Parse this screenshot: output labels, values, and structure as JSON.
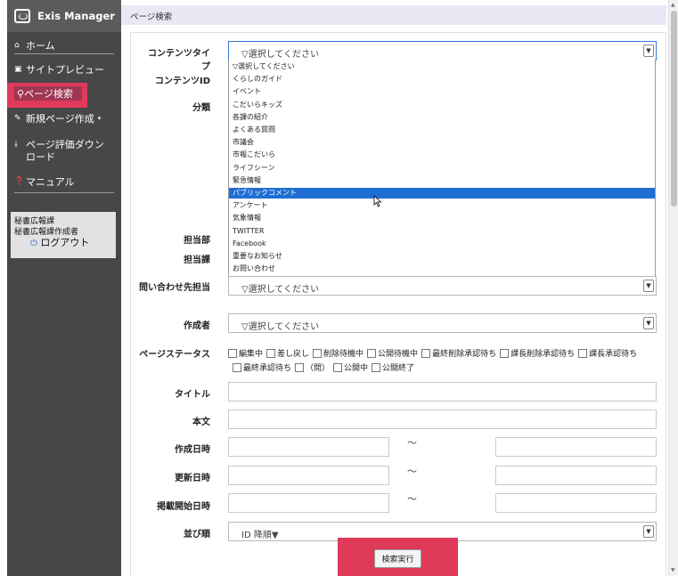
{
  "app": {
    "title": "Exis Manager"
  },
  "nav": {
    "home": "ホーム",
    "site_preview": "サイトプレビュー",
    "page_search": "ページ検索",
    "new_page": "新規ページ作成",
    "eval_download_1": "ページ評価ダウン",
    "eval_download_2": "ロード",
    "manual": "マニュアル"
  },
  "user": {
    "dept": "秘書広報課",
    "role": "秘書広報課作成者",
    "logout": "ログアウト"
  },
  "breadcrumb": "ページ検索",
  "form": {
    "content_type_label": "コンテンツタイプ",
    "content_type_value": "▽選択してください",
    "content_id_label": "コンテンツID",
    "category_label": "分類",
    "dept_label": "担当部",
    "section_label": "担当課",
    "contact_label": "問い合わせ先担当",
    "contact_value": "▽選択してください",
    "author_label": "作成者",
    "author_value": "▽選択してください",
    "status_label": "ページステータス",
    "status_row1": [
      "編集中",
      "差し戻し",
      "削除待機中",
      "公開待機中",
      "最終削除承認待ち",
      "課長削除承認待ち",
      "課長承認待ち"
    ],
    "status_row2": [
      "最終承認待ち",
      "（問）",
      "公開中",
      "公開終了"
    ],
    "title_label": "タイトル",
    "body_label": "本文",
    "created_label": "作成日時",
    "updated_label": "更新日時",
    "published_label": "掲載開始日時",
    "tilde": "～",
    "sort_label": "並び順",
    "sort_value": "ID 降順▼",
    "search_button": "検索実行"
  },
  "dropdown_options": [
    "▽選択してください",
    "くらしのガイド",
    "イベント",
    "こだいらキッズ",
    "各課の紹介",
    "よくある質問",
    "市議会",
    "市報こだいら",
    "ライフシーン",
    "緊急情報",
    "パブリックコメント",
    "アンケート",
    "気象情報",
    "TWITTER",
    "Facebook",
    "重要なお知らせ",
    "お問い合わせ"
  ],
  "dropdown_selected_index": 10,
  "colors": {
    "sidebar": "#474747",
    "highlight": "#e03a5a",
    "selected": "#1f6ed4"
  }
}
